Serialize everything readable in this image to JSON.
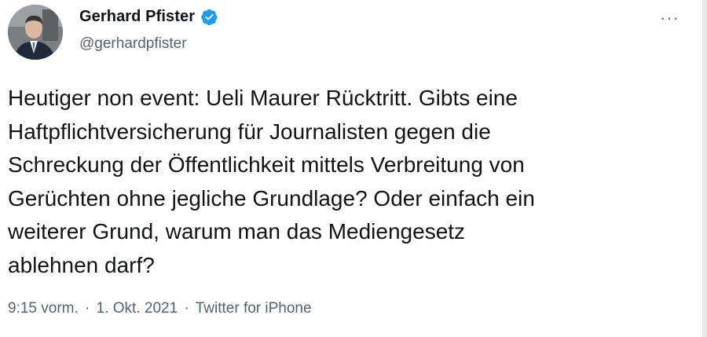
{
  "author": {
    "display_name": "Gerhard Pfister",
    "handle": "@gerhardpfister",
    "verified": true,
    "verified_color": "#1d9bf0",
    "avatar_icon": "profile-photo"
  },
  "menu": {
    "more_label": "···"
  },
  "tweet": {
    "lines": [
      "Heutiger non event: Ueli Maurer Rücktritt. Gibts eine",
      "Haftpflichtversicherung für Journalisten gegen die",
      "Schreckung der Öffentlichkeit mittels Verbreitung von",
      "Gerüchten ohne jegliche Grundlage? Oder einfach ein",
      "weiterer Grund, warum man das Mediengesetz",
      "ablehnen darf?"
    ],
    "time": "9:15 vorm.",
    "date": "1. Okt. 2021",
    "source": "Twitter for iPhone",
    "separator": "·"
  }
}
